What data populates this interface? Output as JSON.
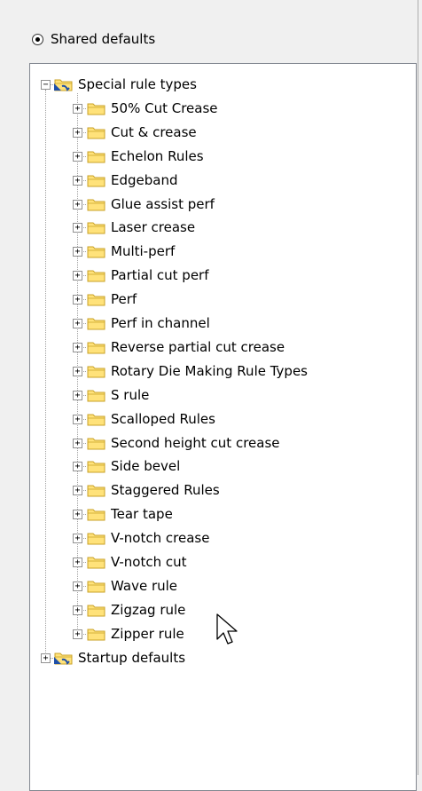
{
  "radio": {
    "label": "Shared defaults",
    "selected": true
  },
  "tree": {
    "root": {
      "label": "Special rule types",
      "expander": "−",
      "expanded": true,
      "icon": "special-folder-icon"
    },
    "children": [
      {
        "label": "50% Cut Crease",
        "expander": "+"
      },
      {
        "label": "Cut & crease",
        "expander": "+"
      },
      {
        "label": "Echelon Rules",
        "expander": "+"
      },
      {
        "label": "Edgeband",
        "expander": "+"
      },
      {
        "label": "Glue assist perf",
        "expander": "+"
      },
      {
        "label": "Laser crease",
        "expander": "+"
      },
      {
        "label": "Multi-perf",
        "expander": "+"
      },
      {
        "label": "Partial cut perf",
        "expander": "+"
      },
      {
        "label": "Perf",
        "expander": "+"
      },
      {
        "label": "Perf in channel",
        "expander": "+"
      },
      {
        "label": "Reverse partial cut crease",
        "expander": "+"
      },
      {
        "label": "Rotary Die Making Rule Types",
        "expander": "+"
      },
      {
        "label": "S rule",
        "expander": "+"
      },
      {
        "label": "Scalloped Rules",
        "expander": "+"
      },
      {
        "label": "Second height cut crease",
        "expander": "+"
      },
      {
        "label": "Side bevel",
        "expander": "+"
      },
      {
        "label": "Staggered Rules",
        "expander": "+"
      },
      {
        "label": "Tear tape",
        "expander": "+"
      },
      {
        "label": "V-notch crease",
        "expander": "+"
      },
      {
        "label": "V-notch cut",
        "expander": "+"
      },
      {
        "label": "Wave rule",
        "expander": "+"
      },
      {
        "label": "Zigzag rule",
        "expander": "+"
      },
      {
        "label": "Zipper rule",
        "expander": "+"
      }
    ],
    "second_root": {
      "label": "Startup defaults",
      "expander": "+",
      "expanded": false,
      "icon": "special-folder-icon"
    }
  },
  "colors": {
    "folder_fill": "#ffe27a",
    "folder_stroke": "#c9a227",
    "special_folder_blue": "#1f4fa8"
  }
}
